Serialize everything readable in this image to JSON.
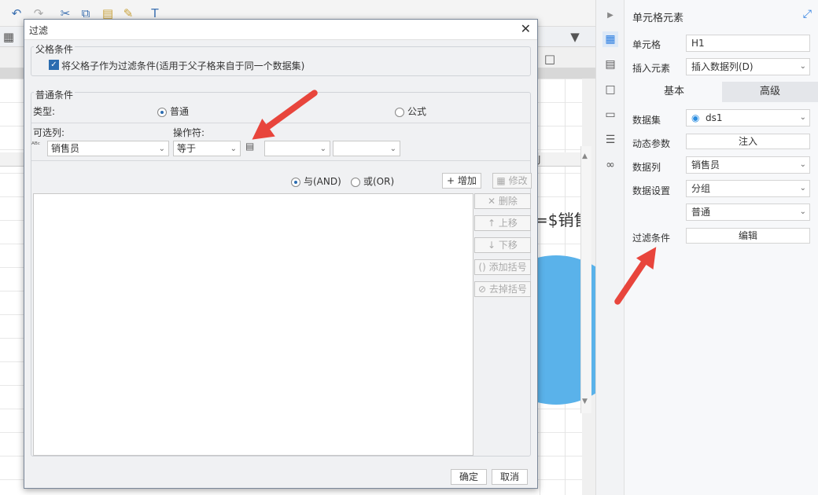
{
  "dialog": {
    "title": "过滤",
    "parent_section": {
      "title": "父格条件",
      "checkbox_label": "将父格子作为过滤条件(适用于父子格来自于同一个数据集)",
      "checked": true
    },
    "normal_section": {
      "title": "普通条件",
      "type_label": "类型:",
      "type_options": [
        "普通",
        "公式"
      ],
      "selected_type": "普通",
      "column_label": "可选列:",
      "column_value": "销售员",
      "operator_label": "操作符:",
      "operator_value": "等于",
      "logic_options": [
        "与(AND)",
        "或(OR)"
      ],
      "selected_logic": "与(AND)",
      "add_button": "增加",
      "modify_button": "修改",
      "side_buttons": [
        "删除",
        "上移",
        "下移",
        "添加括号",
        "去掉括号"
      ]
    },
    "ok_button": "确定",
    "cancel_button": "取消"
  },
  "right_panel": {
    "title": "单元格元素",
    "cell_label": "单元格",
    "cell_value": "H1",
    "insert_label": "插入元素",
    "insert_value": "插入数据列(D)",
    "tabs": [
      "基本",
      "高级"
    ],
    "active_tab": "基本",
    "dataset_label": "数据集",
    "dataset_value": "ds1",
    "dynamic_param_label": "动态参数",
    "dynamic_param_button": "注入",
    "column_label": "数据列",
    "column_value": "销售员",
    "data_setting_label": "数据设置",
    "data_setting_value": "分组",
    "data_setting_sub_value": "普通",
    "filter_label": "过滤条件",
    "filter_button": "编辑"
  },
  "background": {
    "cell_text": "=$销售",
    "column_header": "J"
  },
  "colors": {
    "accent": "#2b6cb0",
    "arrow": "#e8453c",
    "pie": "#5ab2ea"
  }
}
